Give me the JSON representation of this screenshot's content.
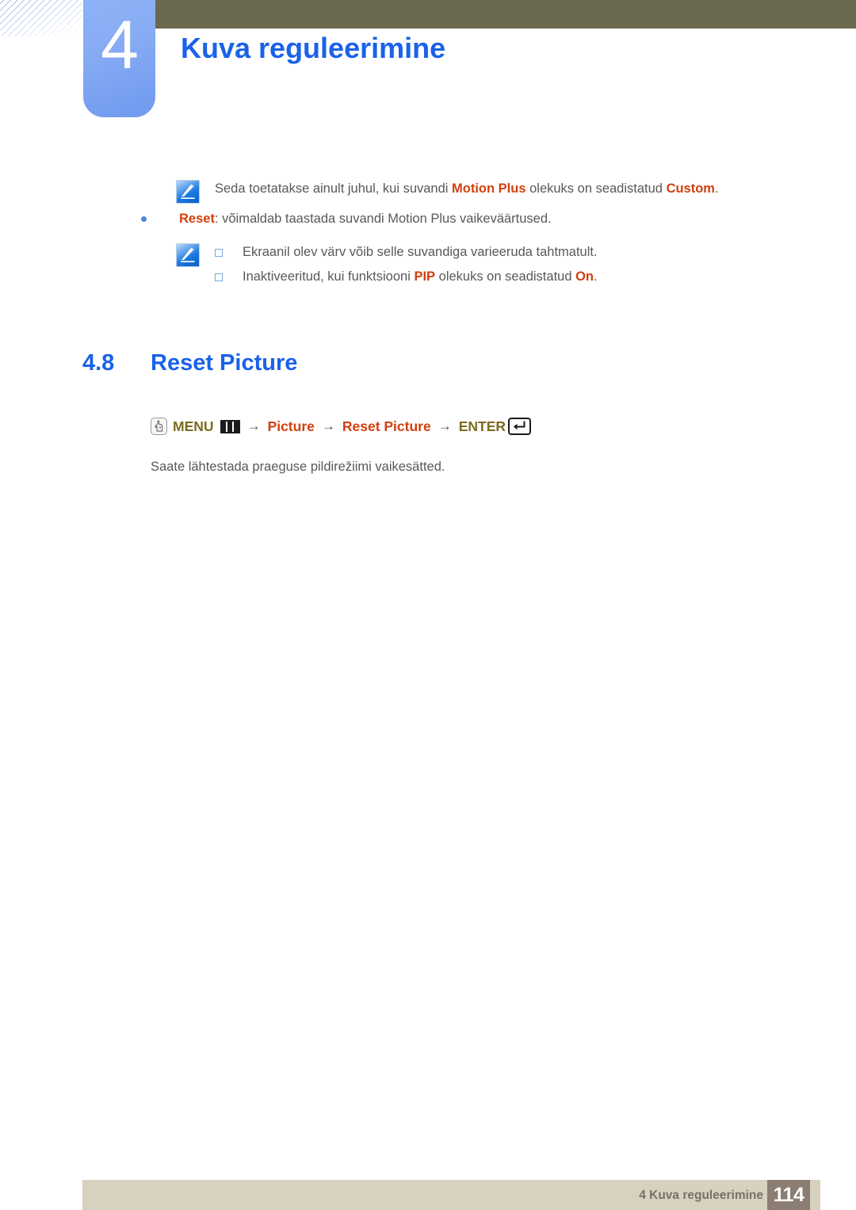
{
  "document": {
    "chapter_number": "4",
    "chapter_title": "Kuva reguleerimine",
    "accent_blue": "#1a62e8",
    "accent_orange": "#d2400e",
    "accent_olive": "#7d6b1f",
    "header_bar_color": "#6b6850",
    "footer_bar_color": "#d7d2c0"
  },
  "notes": {
    "note_one": {
      "icon": "note-pencil-icon",
      "segments": [
        {
          "text": "Seda toetatakse ainult juhul, kui suvandi ",
          "style": "plain"
        },
        {
          "text": "Motion Plus",
          "style": "highlight"
        },
        {
          "text": " olekuks on seadistatud ",
          "style": "plain"
        },
        {
          "text": "Custom",
          "style": "highlight"
        },
        {
          "text": ".",
          "style": "plain"
        }
      ]
    },
    "bullet_reset": {
      "bullet": "dot-bullet-icon",
      "segments": [
        {
          "text": "Reset",
          "style": "highlight"
        },
        {
          "text": ": võimaldab taastada suvandi Motion Plus vaikeväärtused.",
          "style": "plain"
        }
      ]
    },
    "note_two": {
      "icon": "note-pencil-icon",
      "items": [
        {
          "bullet": "square-bullet-icon",
          "segments": [
            {
              "text": "Ekraanil olev värv võib selle suvandiga varieeruda tahtmatult.",
              "style": "plain"
            }
          ]
        },
        {
          "bullet": "square-bullet-icon",
          "segments": [
            {
              "text": "Inaktiveeritud, kui funktsiooni ",
              "style": "plain"
            },
            {
              "text": "PIP",
              "style": "highlight"
            },
            {
              "text": " olekuks on seadistatud ",
              "style": "plain"
            },
            {
              "text": "On",
              "style": "highlight"
            },
            {
              "text": ".",
              "style": "plain"
            }
          ]
        }
      ]
    }
  },
  "section": {
    "number": "4.8",
    "title": "Reset Picture"
  },
  "menu_path": {
    "hand_icon": "hand-press-icon",
    "steps": [
      {
        "label": "MENU",
        "style": "olive",
        "icon": "menu-bars-icon"
      },
      {
        "label": "Picture",
        "style": "orange",
        "icon": ""
      },
      {
        "label": "Reset Picture",
        "style": "orange",
        "icon": ""
      },
      {
        "label": "ENTER",
        "style": "olive",
        "icon": "enter-key-icon"
      }
    ],
    "separator": "→"
  },
  "body_paragraph": "Saate lähtestada praeguse pildirežiimi vaikesätted.",
  "footer": {
    "label": "4 Kuva reguleerimine",
    "page_number": "114"
  }
}
